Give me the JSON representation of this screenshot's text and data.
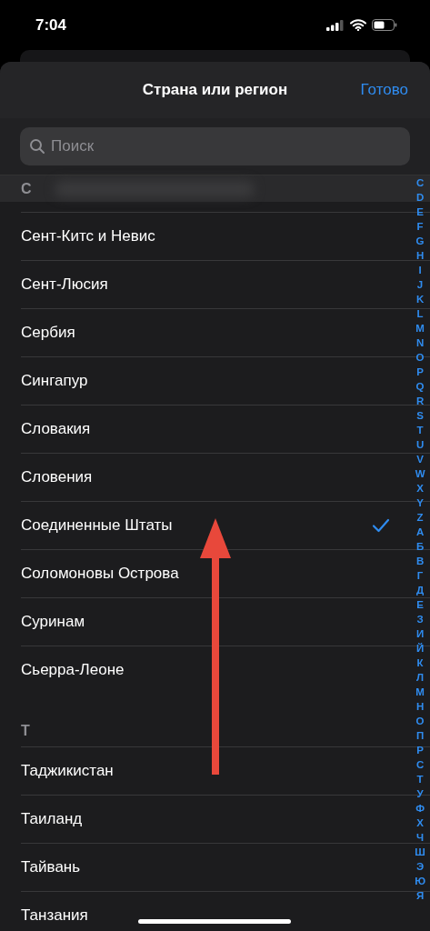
{
  "status_bar": {
    "time": "7:04"
  },
  "header": {
    "title": "Страна или регион",
    "done": "Готово"
  },
  "search": {
    "placeholder": "Поиск"
  },
  "list": [
    {
      "kind": "section",
      "label": "C",
      "pinned": true
    },
    {
      "kind": "row",
      "label": "Сент-Китс и Невис",
      "selected": false
    },
    {
      "kind": "row",
      "label": "Сент-Люсия",
      "selected": false
    },
    {
      "kind": "row",
      "label": "Сербия",
      "selected": false
    },
    {
      "kind": "row",
      "label": "Сингапур",
      "selected": false
    },
    {
      "kind": "row",
      "label": "Словакия",
      "selected": false
    },
    {
      "kind": "row",
      "label": "Словения",
      "selected": false
    },
    {
      "kind": "row",
      "label": "Соединенные Штаты",
      "selected": true
    },
    {
      "kind": "row",
      "label": "Соломоновы Острова",
      "selected": false
    },
    {
      "kind": "row",
      "label": "Суринам",
      "selected": false
    },
    {
      "kind": "row",
      "label": "Сьерра-Леоне",
      "selected": false
    },
    {
      "kind": "section",
      "label": "T",
      "pinned": false
    },
    {
      "kind": "row",
      "label": "Таджикистан",
      "selected": false
    },
    {
      "kind": "row",
      "label": "Таиланд",
      "selected": false
    },
    {
      "kind": "row",
      "label": "Тайвань",
      "selected": false
    },
    {
      "kind": "row",
      "label": "Танзания",
      "selected": false
    }
  ],
  "index": [
    "C",
    "D",
    "E",
    "F",
    "G",
    "H",
    "I",
    "J",
    "K",
    "L",
    "M",
    "N",
    "O",
    "P",
    "Q",
    "R",
    "S",
    "T",
    "U",
    "V",
    "W",
    "X",
    "Y",
    "Z",
    "А",
    "Б",
    "В",
    "Г",
    "Д",
    "Е",
    "З",
    "И",
    "Й",
    "К",
    "Л",
    "М",
    "Н",
    "О",
    "П",
    "Р",
    "С",
    "Т",
    "У",
    "Ф",
    "Х",
    "Ч",
    "Ш",
    "Э",
    "Ю",
    "Я"
  ]
}
